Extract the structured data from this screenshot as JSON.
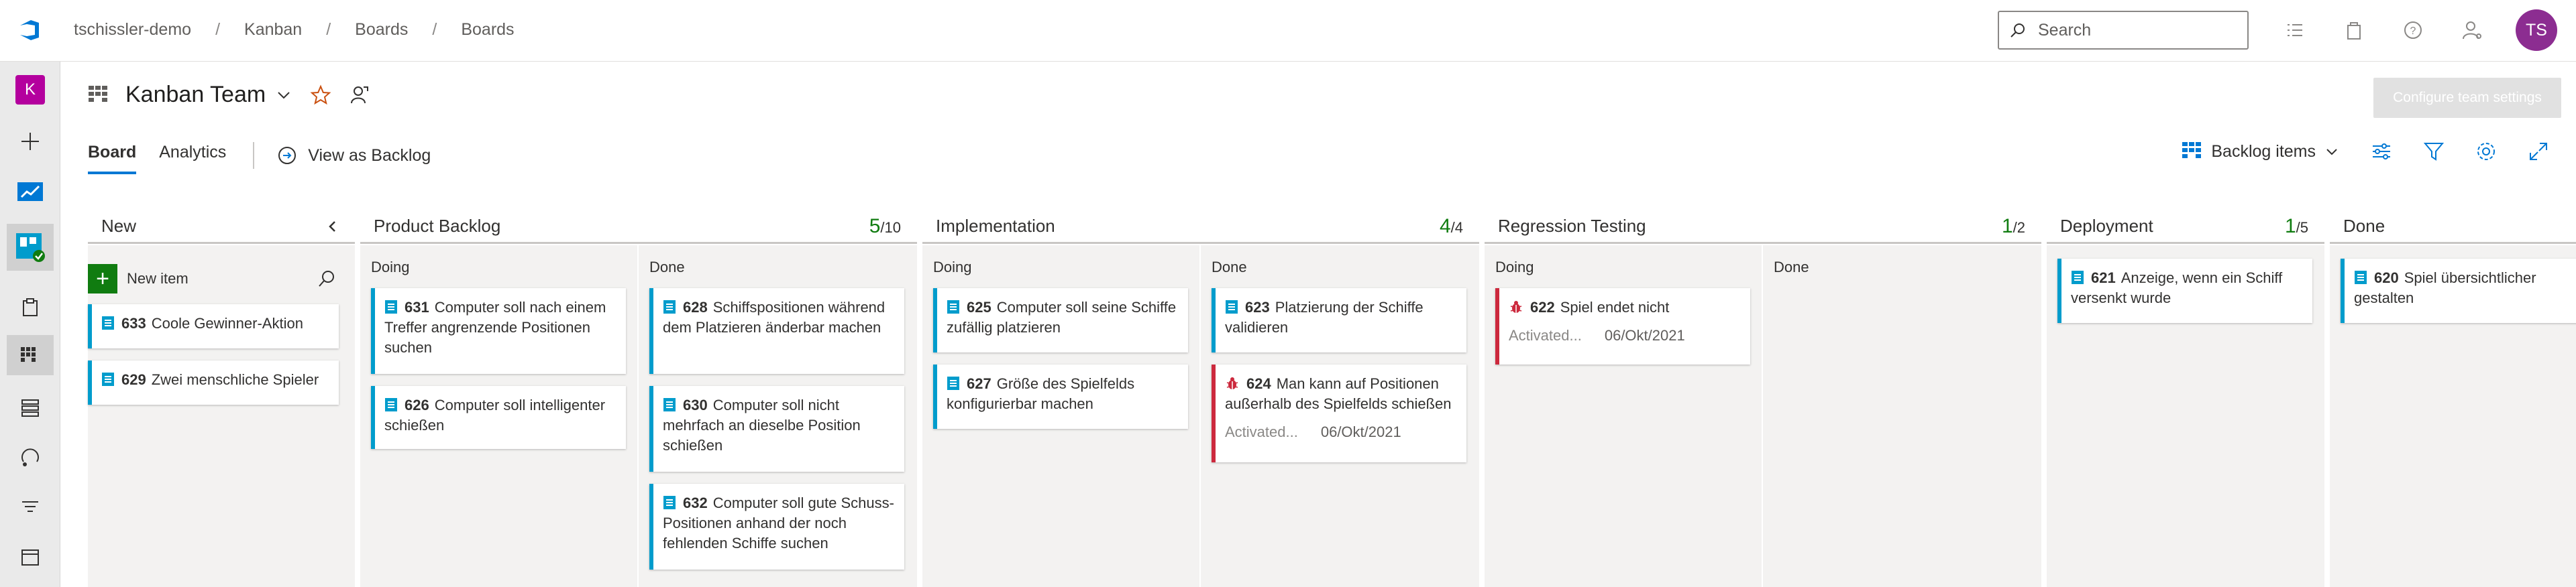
{
  "breadcrumbs": [
    "tschissler-demo",
    "Kanban",
    "Boards",
    "Boards"
  ],
  "search": {
    "placeholder": "Search"
  },
  "user": {
    "initials": "TS"
  },
  "rail": {
    "project_initial": "K"
  },
  "team": {
    "name": "Kanban Team"
  },
  "configure_button": "Configure team settings",
  "tabs": {
    "board": "Board",
    "analytics": "Analytics",
    "view_as_backlog": "View as Backlog"
  },
  "backlog_selector": "Backlog items",
  "columns": {
    "new": {
      "title": "New",
      "new_item_label": "New item",
      "cards": [
        {
          "id": "633",
          "title": "Coole Gewinner-Aktion"
        },
        {
          "id": "629",
          "title": "Zwei menschliche Spieler"
        }
      ]
    },
    "product_backlog": {
      "title": "Product Backlog",
      "count": "5",
      "limit": "/10",
      "doing_label": "Doing",
      "done_label": "Done",
      "doing": [
        {
          "id": "631",
          "title": "Computer soll nach einem Treffer angrenzende Positionen suchen"
        },
        {
          "id": "626",
          "title": "Computer soll intelligenter schießen"
        }
      ],
      "done": [
        {
          "id": "628",
          "title": "Schiffspositionen während dem Platzieren änderbar machen"
        },
        {
          "id": "630",
          "title": "Computer soll nicht mehrfach an dieselbe Position schießen"
        },
        {
          "id": "632",
          "title": "Computer soll gute Schuss-Positionen anhand der noch fehlenden Schiffe suchen"
        }
      ]
    },
    "implementation": {
      "title": "Implementation",
      "count": "4",
      "limit": "/4",
      "doing_label": "Doing",
      "done_label": "Done",
      "doing": [
        {
          "id": "625",
          "title": "Computer soll seine Schiffe zufällig platzieren"
        },
        {
          "id": "627",
          "title": "Größe des Spielfelds konfigurierbar machen"
        }
      ],
      "done": [
        {
          "id": "623",
          "title": "Platzierung der Schiffe validieren"
        },
        {
          "id": "624",
          "title": "Man kann auf Positionen außerhalb des Spielfelds schießen",
          "state": "Activated...",
          "date": "06/Okt/2021"
        }
      ]
    },
    "regression": {
      "title": "Regression Testing",
      "count": "1",
      "limit": "/2",
      "doing_label": "Doing",
      "done_label": "Done",
      "doing": [
        {
          "id": "622",
          "title": "Spiel endet nicht",
          "state": "Activated...",
          "date": "06/Okt/2021"
        }
      ]
    },
    "deployment": {
      "title": "Deployment",
      "count": "1",
      "limit": "/5",
      "cards": [
        {
          "id": "621",
          "title": "Anzeige, wenn ein Schiff versenkt wurde"
        }
      ]
    },
    "done": {
      "title": "Done",
      "cards": [
        {
          "id": "620",
          "title": "Spiel übersichtlicher gestalten"
        }
      ]
    }
  }
}
